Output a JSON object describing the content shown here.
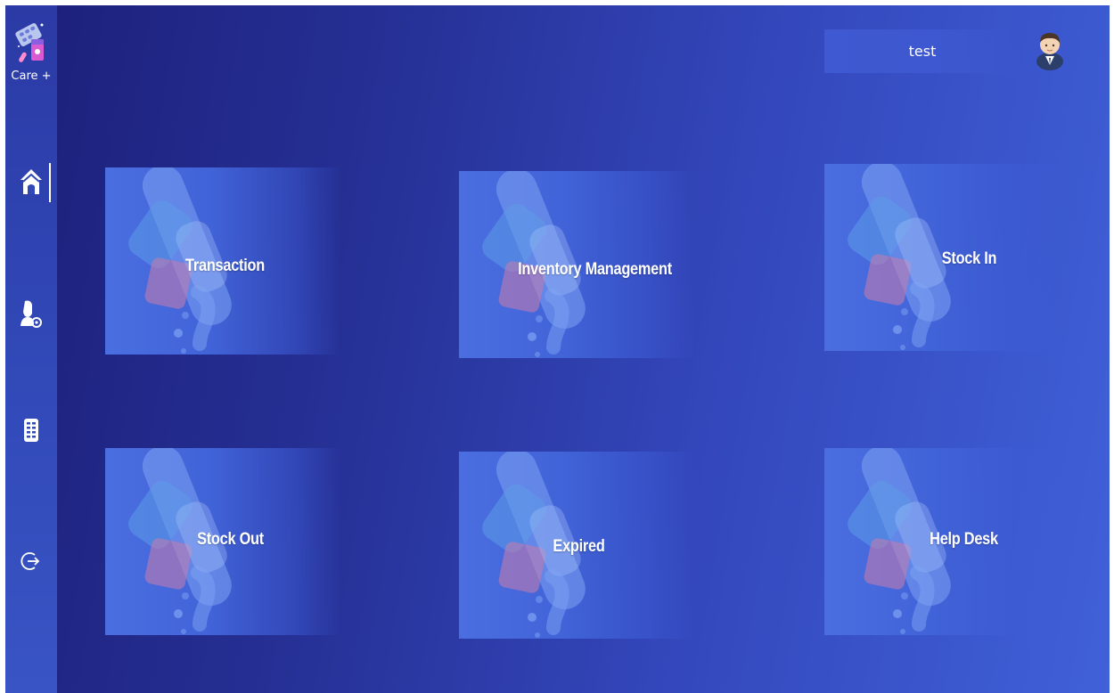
{
  "brand": {
    "name": "Care +",
    "logo_icon": "pill-blister-pack-icon"
  },
  "sidebar": {
    "items": [
      {
        "id": "home",
        "icon": "home-icon",
        "active": true
      },
      {
        "id": "users",
        "icon": "user-settings-icon",
        "active": false
      },
      {
        "id": "list",
        "icon": "clipboard-list-icon",
        "active": false
      },
      {
        "id": "logout",
        "icon": "logout-icon",
        "active": false
      }
    ]
  },
  "header": {
    "username": "test",
    "avatar_icon": "avatar-icon"
  },
  "cards": [
    {
      "label": "Transaction",
      "icon": "medicine-capsule-icon"
    },
    {
      "label": "Inventory Management",
      "icon": "medicine-capsule-icon"
    },
    {
      "label": "Stock In",
      "icon": "medicine-capsule-icon"
    },
    {
      "label": "Stock Out",
      "icon": "medicine-capsule-icon"
    },
    {
      "label": "Expired",
      "icon": "medicine-capsule-icon"
    },
    {
      "label": "Help Desk",
      "icon": "medicine-capsule-icon"
    }
  ],
  "colors": {
    "background_start": "#1c1f7a",
    "background_end": "#4061d8",
    "sidebar": "#3148b7",
    "card": "#4a6ee0",
    "text": "#ffffff"
  }
}
